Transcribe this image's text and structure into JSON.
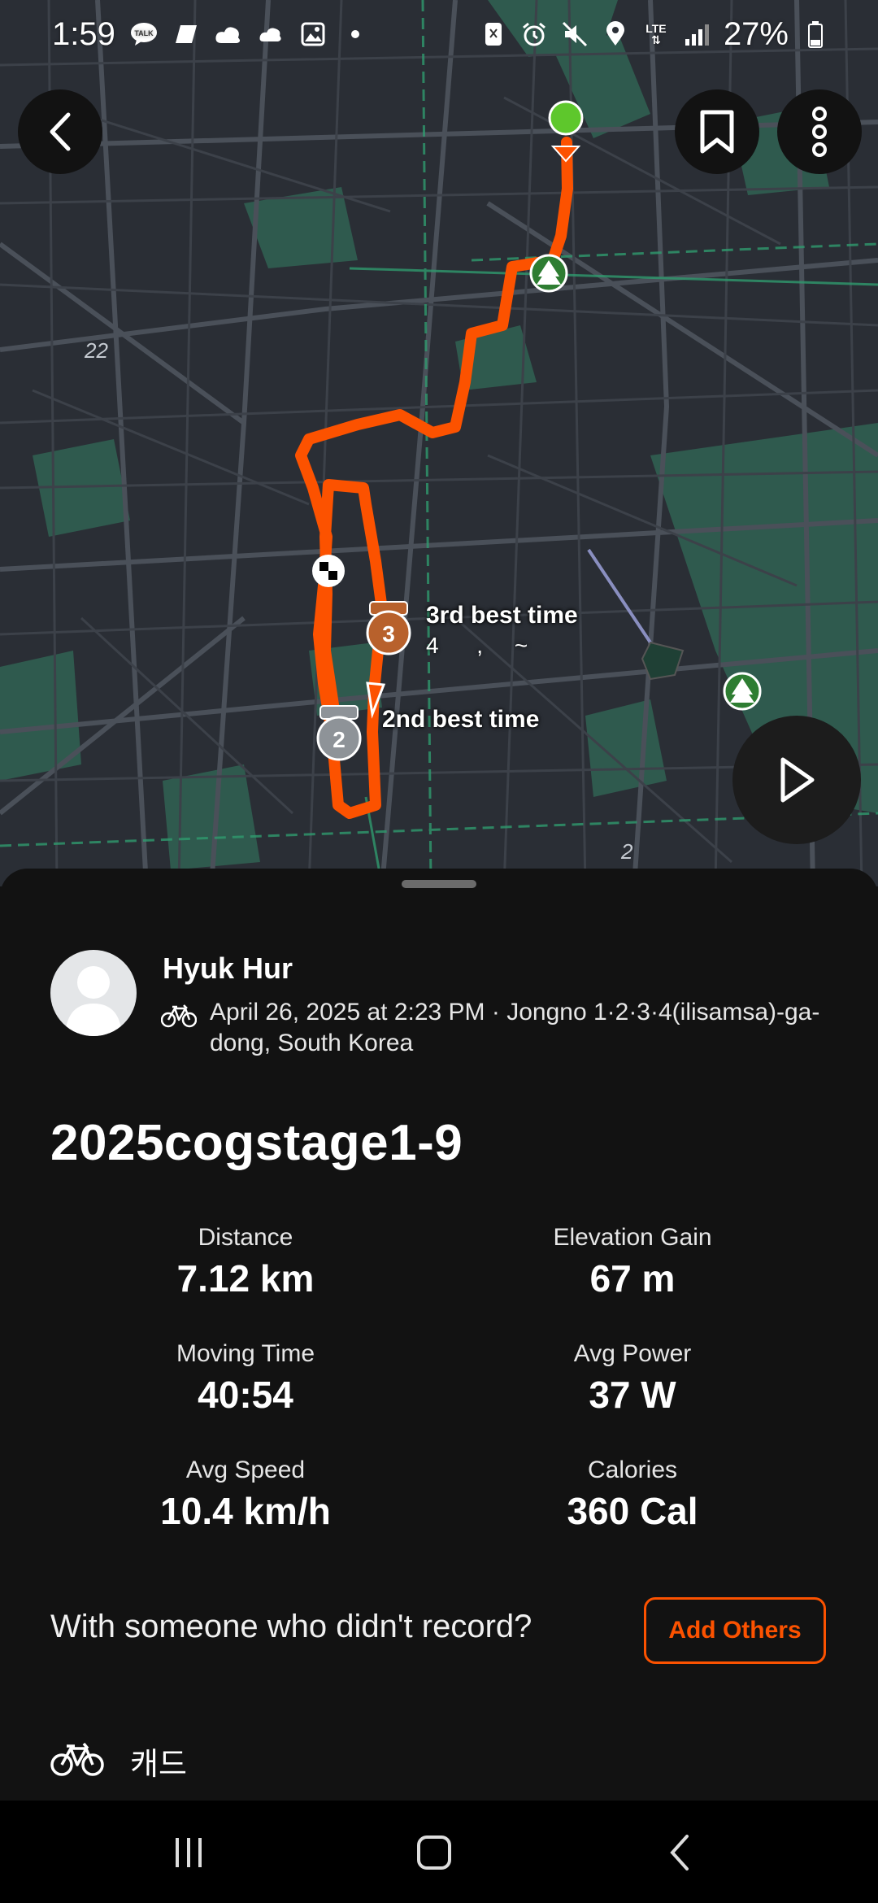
{
  "status_bar": {
    "time": "1:59",
    "battery": "27%",
    "left_icons": [
      "talk-icon",
      "flag-icon",
      "cloud-icon",
      "cloud-icon",
      "gallery-icon",
      "dot-icon"
    ],
    "right_icons": [
      "nfc-icon",
      "alarm-icon",
      "mute-icon",
      "location-icon",
      "lte-icon",
      "signal-icon",
      "battery-icon"
    ],
    "lte": "LTE"
  },
  "map": {
    "road_numbers": [
      "22",
      "2"
    ],
    "segments": [
      {
        "label": "3rd best time",
        "sub": "4      ,     ~",
        "medal": "3"
      },
      {
        "label": "2nd best time",
        "medal": "2"
      }
    ],
    "colors": {
      "route": "#fc5200",
      "start": "#5ec72c",
      "park": "#2e7d32"
    }
  },
  "activity": {
    "athlete_name": "Hyuk Hur",
    "meta": "April 26, 2025 at 2:23 PM · Jongno 1·2·3·4(ilisamsa)-ga-dong, South Korea",
    "sport_icon": "bike-icon",
    "title": "2025cogstage1-9",
    "stats": [
      {
        "label": "Distance",
        "value": "7.12 km"
      },
      {
        "label": "Elevation Gain",
        "value": "67 m"
      },
      {
        "label": "Moving Time",
        "value": "40:54"
      },
      {
        "label": "Avg Power",
        "value": "37 W"
      },
      {
        "label": "Avg Speed",
        "value": "10.4 km/h"
      },
      {
        "label": "Calories",
        "value": "360 Cal"
      }
    ],
    "add_others_prompt": "With someone who didn't record?",
    "add_others_label": "Add Others",
    "gear_name": "캐드"
  },
  "colors": {
    "accent": "#fc5200",
    "sheet_bg": "#121212",
    "map_bg": "#2a2e35"
  }
}
